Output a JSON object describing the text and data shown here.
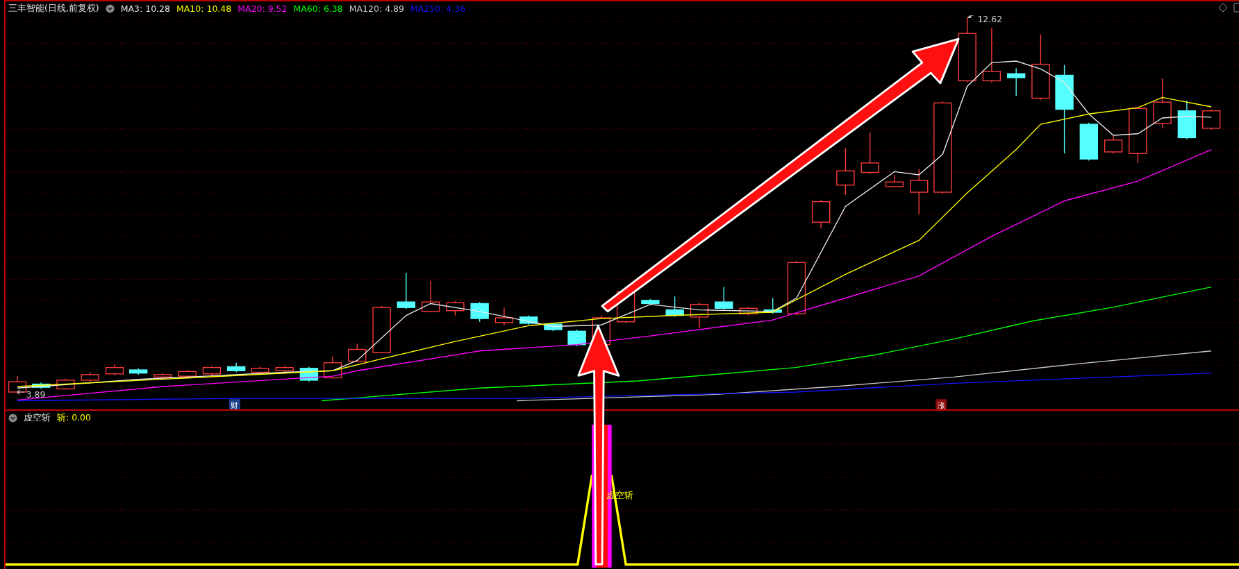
{
  "main_panel": {
    "title": "三丰智能(日线,前复权)",
    "indicators": [
      {
        "label": "MA3: 10.28",
        "color": "#e8e8e8"
      },
      {
        "label": "MA10: 10.48",
        "color": "#ffff00"
      },
      {
        "label": "MA20: 9.52",
        "color": "#ff00ff"
      },
      {
        "label": "MA60: 6.38",
        "color": "#00ff00"
      },
      {
        "label": "MA120: 4.89",
        "color": "#c8c8c8"
      },
      {
        "label": "MA250: 4.36",
        "color": "#1414ff"
      }
    ],
    "high_label": "12.62",
    "low_label": "3.89",
    "markers": [
      {
        "text": "财",
        "kind": "finance"
      },
      {
        "text": "涨",
        "kind": "limit"
      }
    ]
  },
  "sub_panel": {
    "title": "虚空斩",
    "value": "斩: 0.00",
    "signal_label": "虚空斩"
  }
}
